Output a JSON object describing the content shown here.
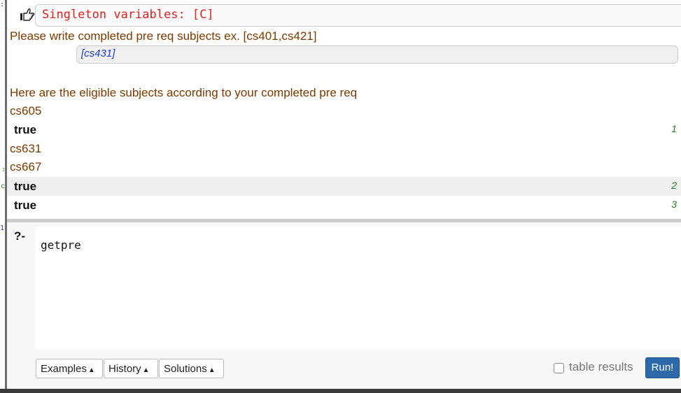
{
  "output": {
    "warning": "Singleton variables: [C]",
    "prompt_line": "Please write completed pre req subjects ex. [cs401,cs421]",
    "user_input": "[cs431]",
    "eligible_heading": "Here are the eligible subjects according to your completed pre req",
    "lines": [
      "cs605",
      "cs631",
      "cs667"
    ],
    "solutions": [
      {
        "value": "true",
        "number": "1"
      },
      {
        "value": "true",
        "number": "2"
      },
      {
        "value": "true",
        "number": "3"
      }
    ]
  },
  "query": {
    "prompt": "?-",
    "code": "getpre"
  },
  "toolbar": {
    "examples_label": "Examples",
    "history_label": "History",
    "solutions_label": "Solutions",
    "caret": "▲",
    "table_results_label": "table results",
    "run_label": "Run!"
  },
  "gutter": {
    "marks": [
      "1",
      ":",
      "c"
    ]
  },
  "colors": {
    "output_text": "#7a3a00",
    "warning": "#e02020",
    "input_text": "#1a3fd0",
    "solution_number": "#1f7a1f",
    "run_button": "#2e6aa9"
  },
  "icons": {
    "pointer": "hand-pointing-icon"
  }
}
